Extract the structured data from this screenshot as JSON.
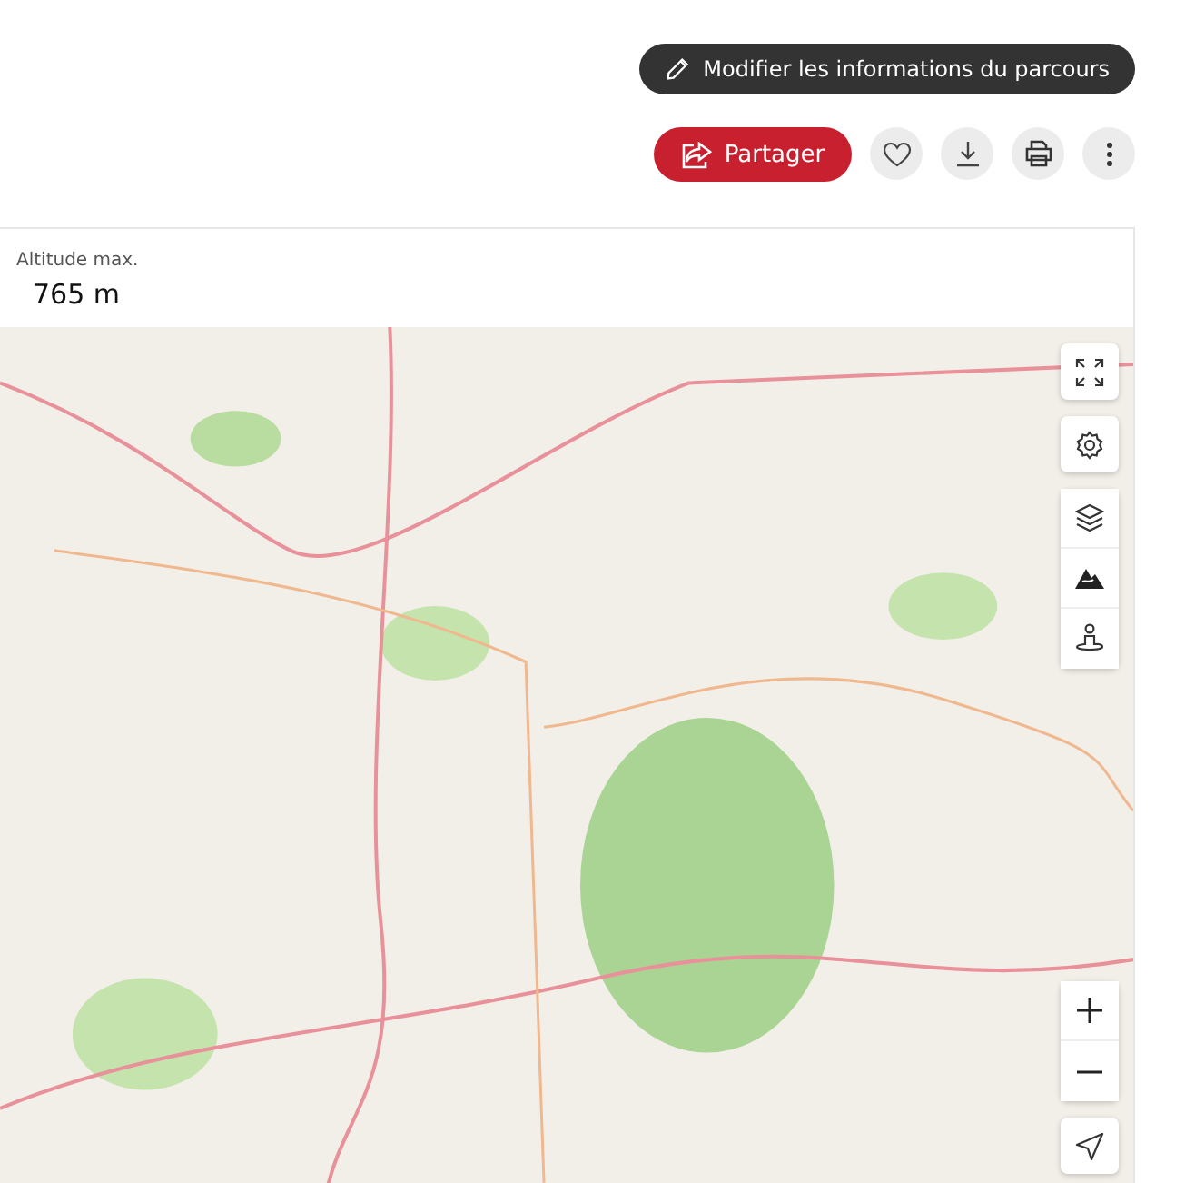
{
  "edit_button": {
    "label": "Modifier les informations du parcours"
  },
  "share_button": {
    "label": "Partager"
  },
  "stat": {
    "label": "Altitude max.",
    "value": "765 m"
  }
}
